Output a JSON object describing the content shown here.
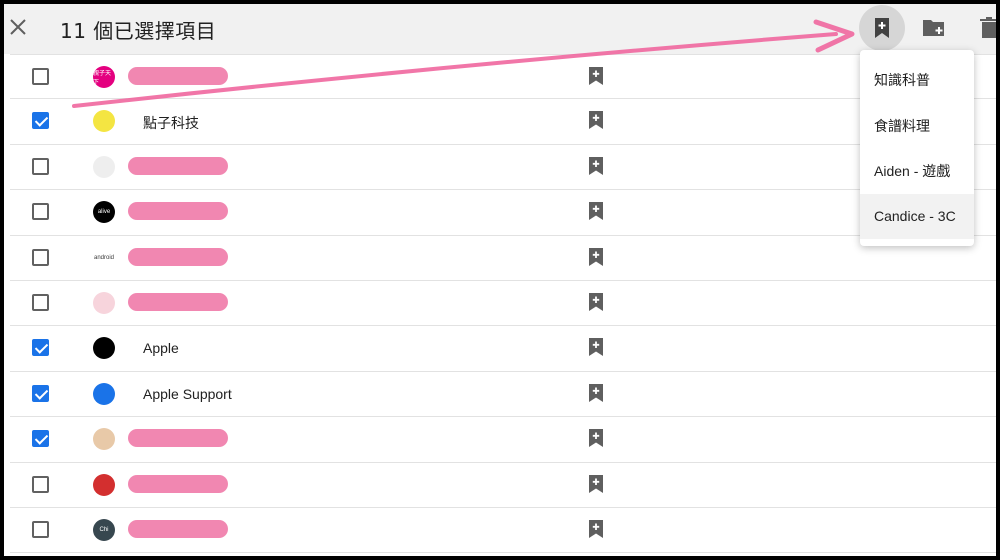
{
  "header": {
    "title": "11 個已選擇項目",
    "close_icon": "close-icon",
    "save_icon": "bookmark-add-icon",
    "folder_icon": "folder-add-icon",
    "trash_icon": "trash-icon"
  },
  "rows": [
    {
      "checked": false,
      "name": "",
      "redacted": true,
      "avatar_color": "#e4007f",
      "avatar_text": "親子天下"
    },
    {
      "checked": true,
      "name": "點子科技",
      "redacted": false,
      "avatar_color": "#f4e542",
      "avatar_text": ""
    },
    {
      "checked": false,
      "name": "",
      "redacted": true,
      "avatar_color": "#eeeeee",
      "avatar_text": ""
    },
    {
      "checked": false,
      "name": "",
      "redacted": true,
      "avatar_color": "#000000",
      "avatar_text": "alive"
    },
    {
      "checked": false,
      "name": "",
      "redacted": true,
      "avatar_color": "#ffffff",
      "avatar_text": "android"
    },
    {
      "checked": false,
      "name": "",
      "redacted": true,
      "avatar_color": "#f7d4dc",
      "avatar_text": ""
    },
    {
      "checked": true,
      "name": "Apple",
      "redacted": false,
      "avatar_color": "#000000",
      "avatar_text": ""
    },
    {
      "checked": true,
      "name": "Apple Support",
      "redacted": false,
      "avatar_color": "#1a73e8",
      "avatar_text": ""
    },
    {
      "checked": true,
      "name": "",
      "redacted": true,
      "avatar_color": "#e8c9a8",
      "avatar_text": ""
    },
    {
      "checked": false,
      "name": "",
      "redacted": true,
      "avatar_color": "#d32f2f",
      "avatar_text": ""
    },
    {
      "checked": false,
      "name": "",
      "redacted": true,
      "avatar_color": "#37474f",
      "avatar_text": "Chi"
    }
  ],
  "dropdown": {
    "items": [
      {
        "label": "知識科普"
      },
      {
        "label": "食譜料理"
      },
      {
        "label": "Aiden - 遊戲"
      },
      {
        "label": "Candice - 3C"
      }
    ]
  },
  "colors": {
    "accent": "#1a73e8",
    "annotation_arrow": "#f0679e",
    "topbar": "#f1f1f1"
  }
}
